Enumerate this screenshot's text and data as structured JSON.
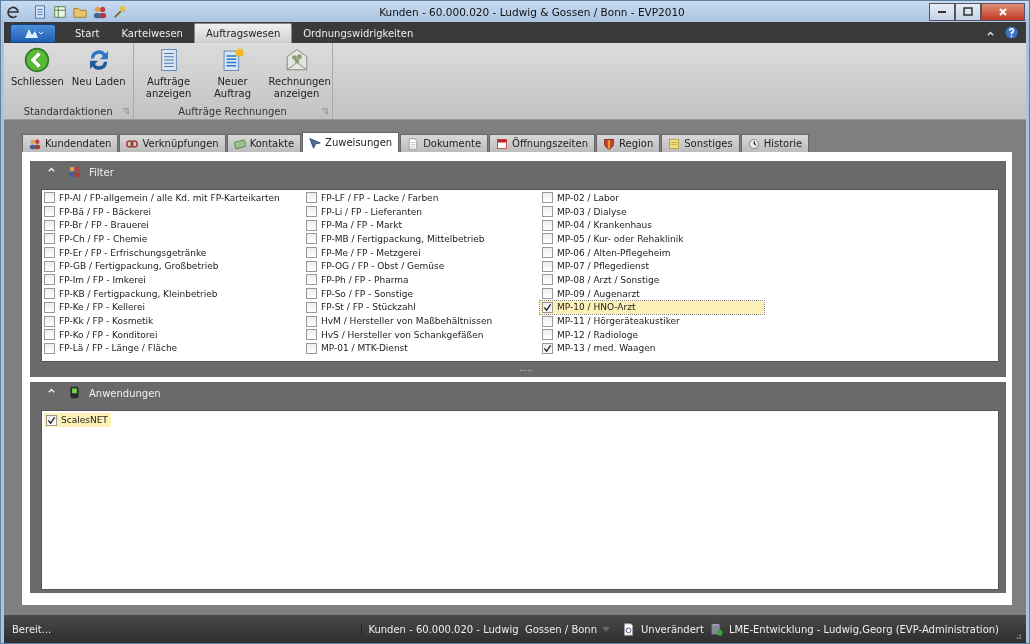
{
  "window": {
    "title": "Kunden - 60.000.020 - Ludwig & Gossen / Bonn - EVP2010"
  },
  "ribbon_tabs": [
    {
      "label": "Start",
      "selected": false
    },
    {
      "label": "Karteiwesen",
      "selected": false
    },
    {
      "label": "Auftragswesen",
      "selected": true
    },
    {
      "label": "Ordnungswidrigkeiten",
      "selected": false
    }
  ],
  "ribbon_groups": [
    {
      "label": "Standardaktionen",
      "buttons": [
        {
          "label": "Schliessen"
        },
        {
          "label": "Neu Laden"
        }
      ]
    },
    {
      "label": "Aufträge Rechnungen",
      "buttons": [
        {
          "label": "Aufträge anzeigen"
        },
        {
          "label": "Neuer Auftrag"
        },
        {
          "label": "Rechnungen anzeigen"
        }
      ]
    }
  ],
  "tabs": [
    {
      "label": "Kundendaten",
      "selected": false
    },
    {
      "label": "Verknüpfungen",
      "selected": false
    },
    {
      "label": "Kontakte",
      "selected": false
    },
    {
      "label": "Zuweisungen",
      "selected": true
    },
    {
      "label": "Dokumente",
      "selected": false
    },
    {
      "label": "Öffnungszeiten",
      "selected": false
    },
    {
      "label": "Region",
      "selected": false
    },
    {
      "label": "Sonstiges",
      "selected": false
    },
    {
      "label": "Historie",
      "selected": false
    }
  ],
  "filter": {
    "title": "Filter",
    "columns": [
      [
        {
          "label": "FP-Al / FP-allgemein / alle Kd. mit FP-Karteikarten",
          "checked": false,
          "selected": false
        },
        {
          "label": "FP-Bä / FP - Bäckerei",
          "checked": false,
          "selected": false
        },
        {
          "label": "FP-Br / FP - Brauerei",
          "checked": false,
          "selected": false
        },
        {
          "label": "FP-Ch / FP - Chemie",
          "checked": false,
          "selected": false
        },
        {
          "label": "FP-Er / FP - Erfrischungsgetränke",
          "checked": false,
          "selected": false
        },
        {
          "label": "FP-GB / Fertigpackung, Großbetrieb",
          "checked": false,
          "selected": false
        },
        {
          "label": "FP-Im / FP - Imkerei",
          "checked": false,
          "selected": false
        },
        {
          "label": "FP-KB / Fertigpackung, Kleinbetrieb",
          "checked": false,
          "selected": false
        },
        {
          "label": "FP-Ke / FP - Kellerei",
          "checked": false,
          "selected": false
        },
        {
          "label": "FP-Kk / FP - Kosmetik",
          "checked": false,
          "selected": false
        },
        {
          "label": "FP-Ko / FP - Konditorei",
          "checked": false,
          "selected": false
        },
        {
          "label": "FP-Lä / FP - Länge / Fläche",
          "checked": false,
          "selected": false
        }
      ],
      [
        {
          "label": "FP-LF / FP - Lacke / Farben",
          "checked": false,
          "selected": false
        },
        {
          "label": "FP-Li / FP - Lieferanten",
          "checked": false,
          "selected": false
        },
        {
          "label": "FP-Ma / FP - Markt",
          "checked": false,
          "selected": false
        },
        {
          "label": "FP-MB / Fertigpackung, Mittelbetrieb",
          "checked": false,
          "selected": false
        },
        {
          "label": "FP-Me / FP - Metzgerei",
          "checked": false,
          "selected": false
        },
        {
          "label": "FP-OG / FP - Obst / Gemüse",
          "checked": false,
          "selected": false
        },
        {
          "label": "FP-Ph / FP - Pharma",
          "checked": false,
          "selected": false
        },
        {
          "label": "FP-So / FP - Sonstige",
          "checked": false,
          "selected": false
        },
        {
          "label": "FP-St / FP - Stückzahl",
          "checked": false,
          "selected": false
        },
        {
          "label": "HvM / Hersteller von Maßbehältnissen",
          "checked": false,
          "selected": false
        },
        {
          "label": "HvS / Hersteller von Schankgefäßen",
          "checked": false,
          "selected": false
        },
        {
          "label": "MP-01 / MTK-Dienst",
          "checked": false,
          "selected": false
        }
      ],
      [
        {
          "label": "MP-02 / Labor",
          "checked": false,
          "selected": false
        },
        {
          "label": "MP-03 / Dialyse",
          "checked": false,
          "selected": false
        },
        {
          "label": "MP-04 / Krankenhaus",
          "checked": false,
          "selected": false
        },
        {
          "label": "MP-05 / Kur- oder Rehaklinik",
          "checked": false,
          "selected": false
        },
        {
          "label": "MP-06 / Alten-Pflegeheim",
          "checked": false,
          "selected": false
        },
        {
          "label": "MP-07 / Pflegedienst",
          "checked": false,
          "selected": false
        },
        {
          "label": "MP-08 / Arzt / Sonstige",
          "checked": false,
          "selected": false
        },
        {
          "label": "MP-09 / Augenarzt",
          "checked": false,
          "selected": false
        },
        {
          "label": "MP-10 / HNO-Arzt",
          "checked": true,
          "selected": true
        },
        {
          "label": "MP-11 / Hörgeräteakustiker",
          "checked": false,
          "selected": false
        },
        {
          "label": "MP-12 / Radiologe",
          "checked": false,
          "selected": false
        },
        {
          "label": "MP-13 / med. Waagen",
          "checked": true,
          "selected": false
        }
      ]
    ]
  },
  "applications": {
    "title": "Anwendungen",
    "items": [
      {
        "label": "ScalesNET",
        "checked": true,
        "selected": true
      }
    ]
  },
  "status_bar": {
    "left": "Bereit...",
    "record": "Kunden - 60.000.020 - Ludwig  Gossen / Bonn",
    "state": "Unverändert",
    "user": "LME-Entwicklung - Ludwig,Georg (EVP-Administration)"
  }
}
